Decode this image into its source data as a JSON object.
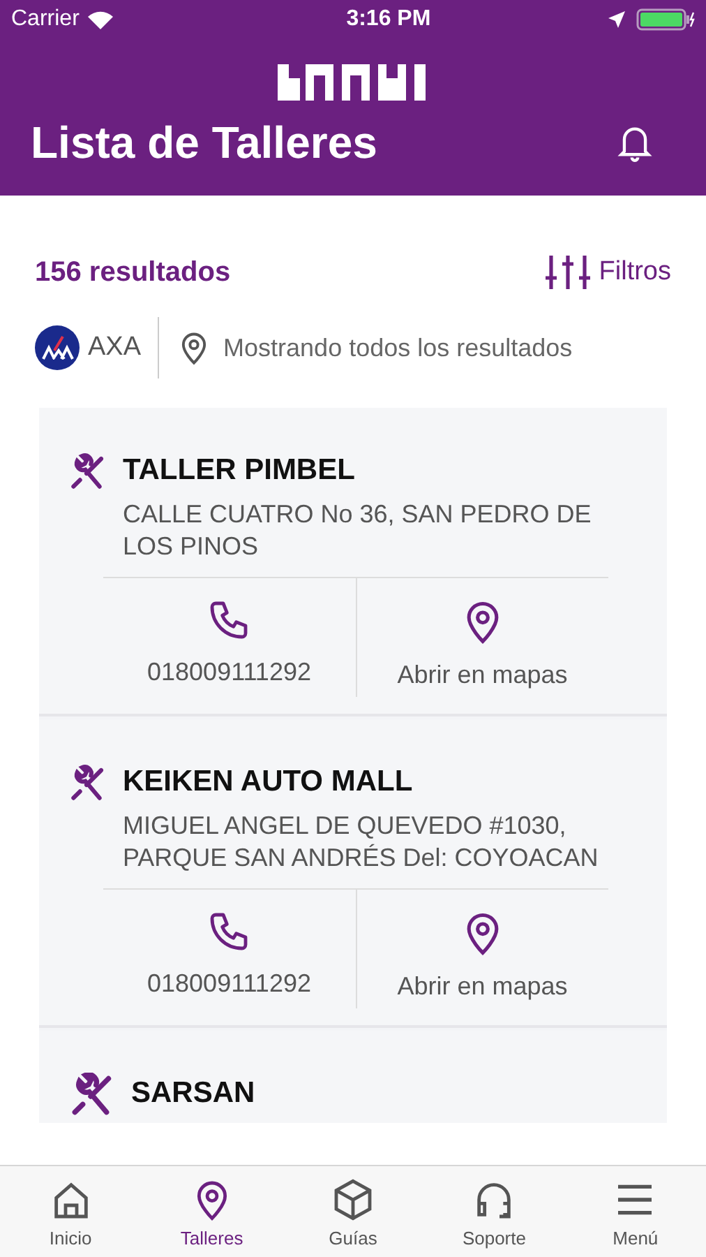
{
  "status_bar": {
    "carrier": "Carrier",
    "time": "3:16 PM"
  },
  "header": {
    "title": "Lista de Talleres"
  },
  "results": {
    "count": "156 resultados",
    "filter_label": "Filtros"
  },
  "insurer": {
    "name": "AXA",
    "location_text": "Mostrando todos los resultados"
  },
  "workshops": [
    {
      "name": "TALLER PIMBEL",
      "address": "CALLE CUATRO No 36, SAN PEDRO DE LOS PINOS",
      "phone": "018009111292",
      "map_label": "Abrir en mapas"
    },
    {
      "name": "KEIKEN AUTO MALL",
      "address": "MIGUEL ANGEL DE QUEVEDO #1030, PARQUE SAN ANDRÉS Del: COYOACAN",
      "phone": "018009111292",
      "map_label": "Abrir en mapas"
    },
    {
      "name": "SARSAN"
    }
  ],
  "tab_bar": [
    {
      "label": "Inicio",
      "kind": "home",
      "selected": false
    },
    {
      "label": "Talleres",
      "kind": "pin",
      "selected": true
    },
    {
      "label": "Guías",
      "kind": "box",
      "selected": false
    },
    {
      "label": "Soporte",
      "kind": "headset",
      "selected": false
    },
    {
      "label": "Menú",
      "kind": "menu",
      "selected": false
    }
  ]
}
